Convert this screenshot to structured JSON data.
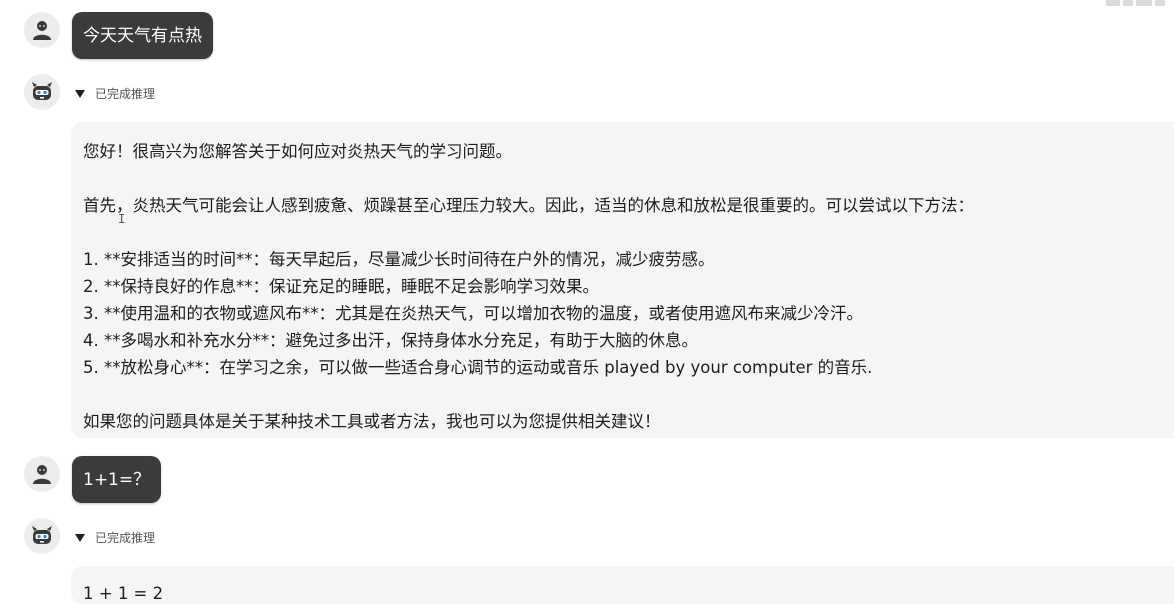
{
  "messages": [
    {
      "role": "user",
      "avatar": "user-avatar-icon",
      "text": "今天天气有点热"
    },
    {
      "role": "assistant",
      "avatar": "robot-avatar-icon",
      "reasoning_label": "已完成推理",
      "paragraphs": [
        "您好！很高兴为您解答关于如何应对炎热天气的学习问题。",
        "首先，炎热天气可能会让人感到疲惫、烦躁甚至心理压力较大。因此，适当的休息和放松是很重要的。可以尝试以下方法：",
        "1. **安排适当的时间**：每天早起后，尽量减少长时间待在户外的情况，减少疲劳感。",
        "2. **保持良好的作息**：保证充足的睡眠，睡眠不足会影响学习效果。",
        "3. **使用温和的衣物或遮风布**：尤其是在炎热天气，可以增加衣物的温度，或者使用遮风布来减少冷汗。",
        "4. **多喝水和补充水分**：避免过多出汗，保持身体水分充足，有助于大脑的休息。",
        "5. **放松身心**：在学习之余，可以做一些适合身心调节的运动或音乐 played by your computer 的音乐.",
        "如果您的问题具体是关于某种技术工具或者方法，我也可以为您提供相关建议！"
      ]
    },
    {
      "role": "user",
      "avatar": "user-avatar-icon",
      "text": "1+1=？"
    },
    {
      "role": "assistant",
      "avatar": "robot-avatar-icon",
      "reasoning_label": "已完成推理",
      "paragraphs": [
        "1 + 1 = 2"
      ]
    }
  ],
  "colors": {
    "user_bubble": "#3b3b3b",
    "assistant_bubble": "#f5f5f5",
    "page_background": "#ffffff"
  }
}
